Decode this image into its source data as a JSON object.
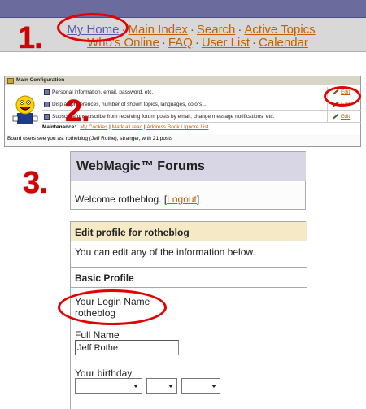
{
  "steps": [
    "1.",
    "2.",
    "3."
  ],
  "nav": {
    "row1": [
      "My Home",
      "Main Index",
      "Search",
      "Active Topics"
    ],
    "row2": [
      "Who's Online",
      "FAQ",
      "User List",
      "Calendar"
    ],
    "separator": "·"
  },
  "config": {
    "title": "Main Configuration",
    "rows": [
      {
        "text": "Personal information, email, password, etc.",
        "edit": "Edit"
      },
      {
        "text": "Display preferences, number of shown topics, languages, colors...",
        "edit": "Edit"
      },
      {
        "text": "Subscribe/unsubscribe from receiving forum posts by email, change message notifications, etc.",
        "edit": "Edit"
      }
    ],
    "maintenance_label": "Maintenance:",
    "maintenance_links": [
      "My Cookies",
      "Mark all read",
      "Address Book / Ignore List"
    ],
    "maintenance_sep": "|",
    "board_note": "Board users see you as: rotheblog (Jeff Rothe), stranger, with 21 posts"
  },
  "profile": {
    "forum_title": "WebMagic™ Forums",
    "welcome_prefix": "Welcome rotheblog. [",
    "logout": "Logout",
    "welcome_suffix": "]",
    "edit_title": "Edit profile for rotheblog",
    "intro": "You can edit any of the information below.",
    "basic_profile": "Basic Profile",
    "login_label": "Your Login Name",
    "login_value": "rotheblog",
    "fullname_label": "Full Name",
    "fullname_value": "Jeff Rothe",
    "birthday_label": "Your birthday"
  },
  "colors": {
    "annotation": "#e30000",
    "link": "#c06000",
    "forum_header_bg": "#d8d6e4",
    "edit_header_bg": "#f5e9c6"
  }
}
